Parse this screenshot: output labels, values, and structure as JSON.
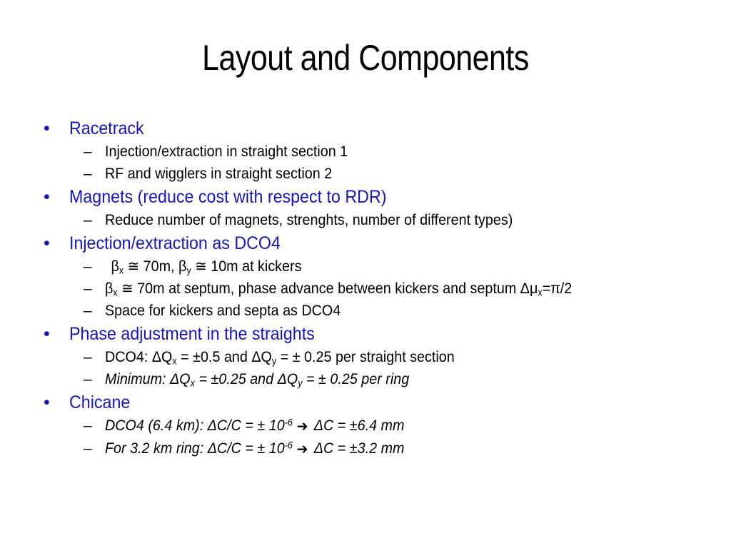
{
  "slide": {
    "title": "Layout and Components",
    "accent_color": "#1414CC",
    "text_color": "#000000",
    "background_color": "#FFFFFF",
    "bullet_marker": "•",
    "dash_marker": "–",
    "arrow_marker": "➔",
    "bullets": [
      {
        "level": 1,
        "text": "Racetrack"
      },
      {
        "level": 2,
        "text": "Injection/extraction in straight section 1"
      },
      {
        "level": 2,
        "text": "RF and wigglers in straight section 2"
      },
      {
        "level": 1,
        "text": "Magnets (reduce cost with respect to RDR)"
      },
      {
        "level": 2,
        "text": "Reduce number of magnets, strenghts, number of different types)"
      },
      {
        "level": 1,
        "text": "Injection/extraction as DCO4"
      },
      {
        "level": 2,
        "text": "βx ≅ 70m, βy ≅ 10m at kickers"
      },
      {
        "level": 2,
        "text": "βx ≅ 70m at septum, phase advance between kickers and septum Δμx=π/2"
      },
      {
        "level": 2,
        "text": "Space for kickers and septa as DCO4"
      },
      {
        "level": 1,
        "text": "Phase adjustment in the straights"
      },
      {
        "level": 2,
        "text": "DCO4: ΔQx = ±0.5 and ΔQy = ± 0.25 per straight section"
      },
      {
        "level": 2,
        "italic": true,
        "text": "Minimum: ΔQx = ±0.25 and ΔQy = ± 0.25 per ring"
      },
      {
        "level": 1,
        "text": "Chicane"
      },
      {
        "level": 2,
        "italic": true,
        "text": "DCO4 (6.4 km):  ΔC/C = ± 10-6  ➔  ΔC = ±6.4 mm"
      },
      {
        "level": 2,
        "italic": true,
        "text": "For 3.2 km ring:  ΔC/C = ± 10-6  ➔  ΔC = ±3.2 mm"
      }
    ],
    "rich": {
      "beta_x_kickers_a": "β",
      "beta_x_kickers_sub_a": "x",
      "beta_x_kickers_mid": " ≅ 70m, ",
      "beta_y": "β",
      "beta_y_sub": "y",
      "beta_y_tail": " ≅ 10m at kickers",
      "septum_beta": "β",
      "septum_beta_sub": "x",
      "septum_mid": " ≅ 70m at septum, phase advance between kickers and septum ",
      "septum_delta_mu": "Δμ",
      "septum_delta_mu_sub": "x",
      "septum_tail": "=π/2",
      "dco4_lead": "DCO4: ",
      "dco4_dq1": "ΔQ",
      "dco4_dq1_sub": "x",
      "dco4_mid": " = ±0.5 and ",
      "dco4_dq2": "ΔQ",
      "dco4_dq2_sub": "y",
      "dco4_tail": " = ± 0.25 per straight section",
      "min_lead": "Minimum: ",
      "min_dq1": "ΔQ",
      "min_dq1_sub": "x",
      "min_mid": " = ±0.25 and ",
      "min_dq2": "ΔQ",
      "min_dq2_sub": "y",
      "min_tail": " = ± 0.25 per ring",
      "chic1_lead": "DCO4 (6.4 km):  ΔC/C = ± 10",
      "chic1_sup": "-6",
      "chic1_tail": "ΔC = ±6.4 mm",
      "chic2_lead": "For 3.2 km ring:  ΔC/C = ± 10",
      "chic2_sup": "-6",
      "chic2_tail": "ΔC = ±3.2 mm"
    }
  }
}
